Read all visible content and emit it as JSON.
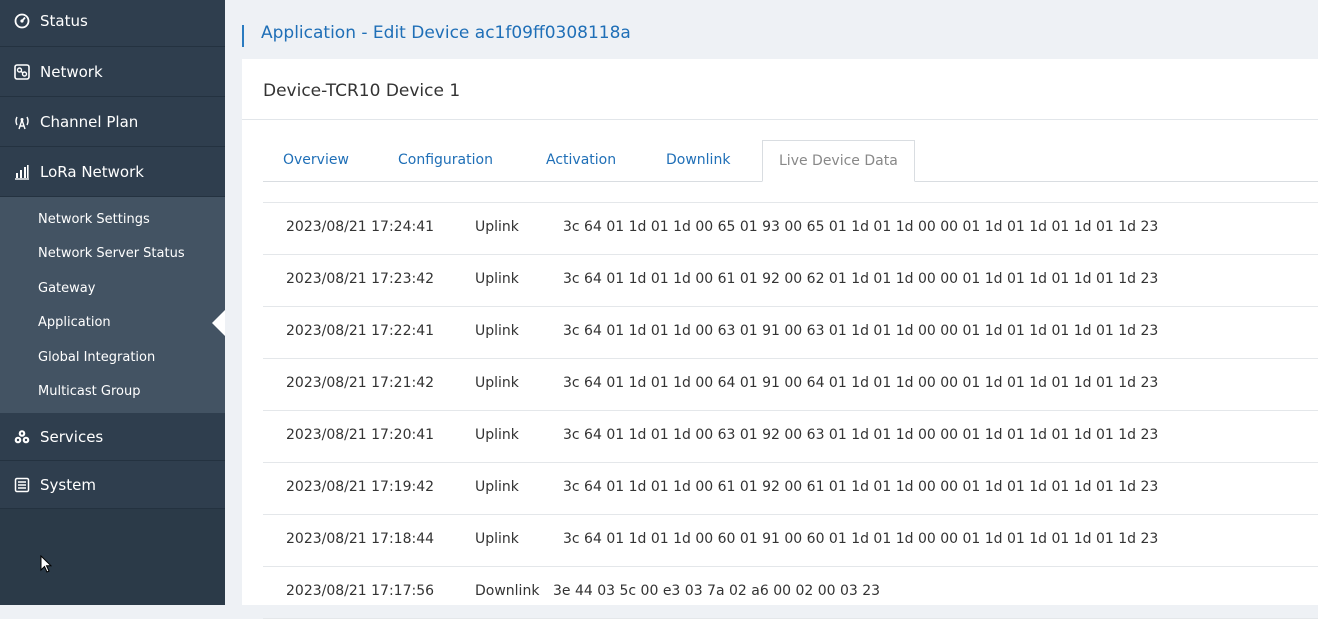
{
  "sidebar": {
    "items": [
      {
        "label": "Status",
        "icon": "status-icon"
      },
      {
        "label": "Network",
        "icon": "network-icon"
      },
      {
        "label": "Channel Plan",
        "icon": "antenna-icon"
      },
      {
        "label": "LoRa Network",
        "icon": "signal-bars-icon"
      }
    ],
    "submenu": [
      {
        "label": "Network Settings"
      },
      {
        "label": "Network Server Status"
      },
      {
        "label": "Gateway"
      },
      {
        "label": "Application"
      },
      {
        "label": "Global Integration"
      },
      {
        "label": "Multicast Group"
      }
    ],
    "active_submenu": "Application",
    "bottom_items": [
      {
        "label": "Services",
        "icon": "services-icon"
      },
      {
        "label": "System",
        "icon": "system-icon"
      }
    ]
  },
  "header": {
    "title": "Application - Edit Device ac1f09ff0308118a"
  },
  "device": {
    "title": "Device-TCR10 Device 1"
  },
  "tabs": [
    {
      "label": "Overview"
    },
    {
      "label": "Configuration"
    },
    {
      "label": "Activation"
    },
    {
      "label": "Downlink"
    },
    {
      "label": "Live Device Data"
    }
  ],
  "active_tab": "Live Device Data",
  "log": [
    {
      "time": "2023/08/21 17:24:41",
      "type": "Uplink",
      "data": "3c 64 01 1d 01 1d 00 65 01 93 00 65 01 1d 01 1d 00 00 01 1d 01 1d 01 1d 01 1d 23"
    },
    {
      "time": "2023/08/21 17:23:42",
      "type": "Uplink",
      "data": "3c 64 01 1d 01 1d 00 61 01 92 00 62 01 1d 01 1d 00 00 01 1d 01 1d 01 1d 01 1d 23"
    },
    {
      "time": "2023/08/21 17:22:41",
      "type": "Uplink",
      "data": "3c 64 01 1d 01 1d 00 63 01 91 00 63 01 1d 01 1d 00 00 01 1d 01 1d 01 1d 01 1d 23"
    },
    {
      "time": "2023/08/21 17:21:42",
      "type": "Uplink",
      "data": "3c 64 01 1d 01 1d 00 64 01 91 00 64 01 1d 01 1d 00 00 01 1d 01 1d 01 1d 01 1d 23"
    },
    {
      "time": "2023/08/21 17:20:41",
      "type": "Uplink",
      "data": "3c 64 01 1d 01 1d 00 63 01 92 00 63 01 1d 01 1d 00 00 01 1d 01 1d 01 1d 01 1d 23"
    },
    {
      "time": "2023/08/21 17:19:42",
      "type": "Uplink",
      "data": "3c 64 01 1d 01 1d 00 61 01 92 00 61 01 1d 01 1d 00 00 01 1d 01 1d 01 1d 01 1d 23"
    },
    {
      "time": "2023/08/21 17:18:44",
      "type": "Uplink",
      "data": "3c 64 01 1d 01 1d 00 60 01 91 00 60 01 1d 01 1d 00 00 01 1d 01 1d 01 1d 01 1d 23"
    },
    {
      "time": "2023/08/21 17:17:56",
      "type": "Downlink",
      "data": "3e 44 03 5c 00 e3 03 7a 02 a6 00 02 00 03 23"
    }
  ],
  "colors": {
    "sidebar_bg": "#2f3e4e",
    "submenu_bg": "#435363",
    "accent": "#1f6fb7"
  }
}
